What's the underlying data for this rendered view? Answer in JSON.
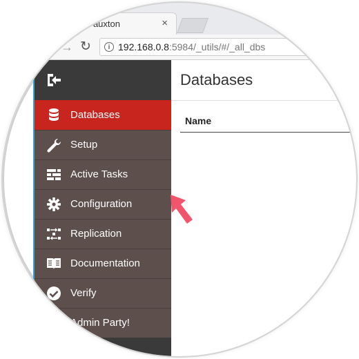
{
  "browser": {
    "tab_title": "Fauxton",
    "tab_close_glyph": "×",
    "url_host": "192.168.0.8",
    "url_rest": ":5984/_utils/#/_all_dbs",
    "forward_glyph": "→",
    "reload_glyph": "↻"
  },
  "sidebar": {
    "items": [
      {
        "label": "Databases",
        "icon": "database-icon",
        "active": true
      },
      {
        "label": "Setup",
        "icon": "wrench-icon"
      },
      {
        "label": "Active Tasks",
        "icon": "tasks-icon"
      },
      {
        "label": "Configuration",
        "icon": "gear-icon"
      },
      {
        "label": "Replication",
        "icon": "replication-icon"
      },
      {
        "label": "Documentation",
        "icon": "book-icon"
      },
      {
        "label": "Verify",
        "icon": "check-circle-icon"
      },
      {
        "label": "Admin Party!",
        "icon": "party-icon"
      }
    ]
  },
  "main": {
    "title": "Databases",
    "table_header": "Name"
  },
  "colors": {
    "accent": "#c9251f",
    "sidebar_bg": "#5c4f4c",
    "pointer": "#f0556b"
  }
}
